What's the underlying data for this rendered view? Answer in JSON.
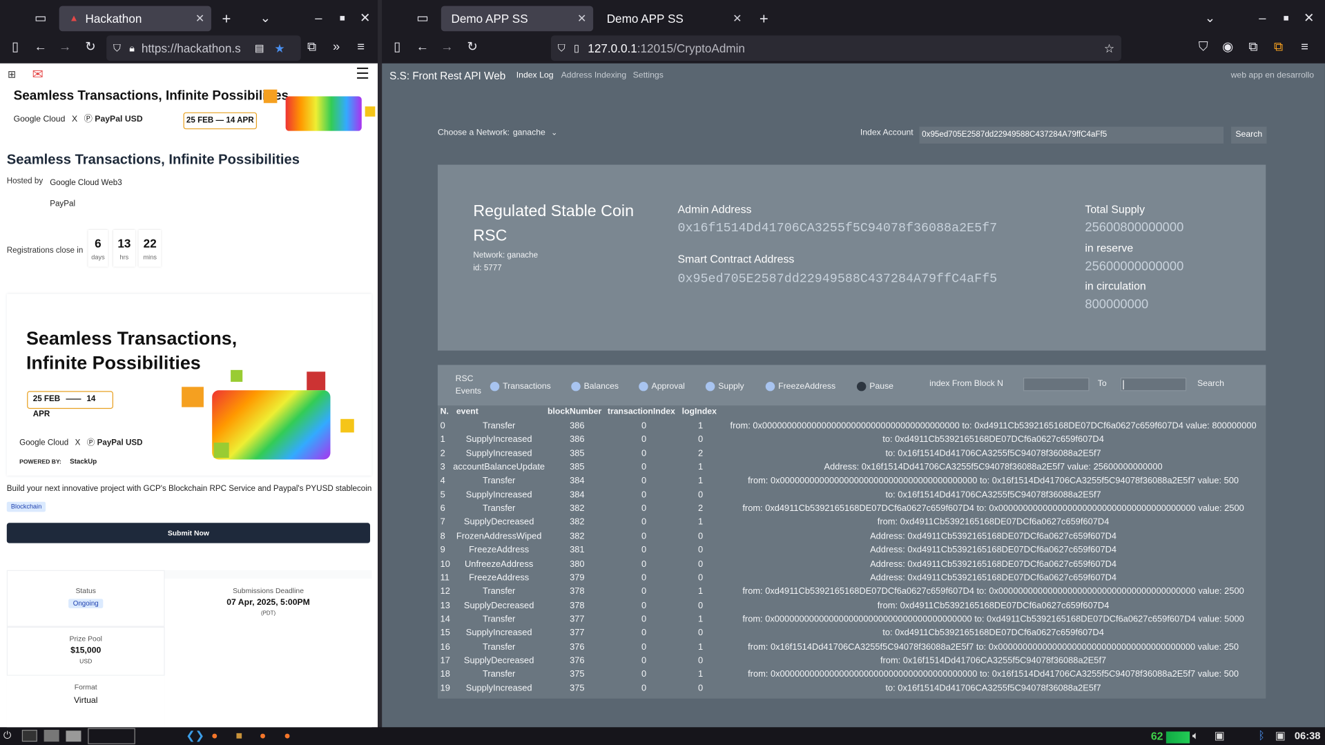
{
  "left_window": {
    "tab_title": "Hackathon",
    "url": "https://hackathon.s",
    "banner_title": "Seamless Transactions, Infinite Possibilities",
    "banner_brand_1": "Google Cloud",
    "banner_x": "X",
    "banner_brand_2": "PayPal USD",
    "banner_dates": "25 FEB — 14 APR",
    "title": "Seamless Transactions, Infinite Possibilities",
    "hosted_by_label": "Hosted by",
    "host_1": "Google Cloud Web3",
    "host_2": "PayPal",
    "registrations_label": "Registrations close in",
    "countdown": [
      {
        "value": "6",
        "unit": "days"
      },
      {
        "value": "13",
        "unit": "hrs"
      },
      {
        "value": "22",
        "unit": "mins"
      }
    ],
    "hero_title_1": "Seamless Transactions,",
    "hero_title_2": "Infinite Possibilities",
    "hero_date_from": "25 FEB",
    "hero_date_to": "14 APR",
    "hero_brand_1": "Google Cloud",
    "hero_brand_2": "PayPal USD",
    "hero_powered": "POWERED BY:",
    "hero_powered_brand": "StackUp",
    "description": "Build your next innovative project with GCP's Blockchain RPC Service and Paypal's PYUSD stablecoin",
    "tag": "Blockchain",
    "submit_label": "Submit Now",
    "status_label": "Status",
    "status_value": "Ongoing",
    "deadline_label": "Submissions Deadline",
    "deadline_value": "07 Apr, 2025, 5:00PM",
    "deadline_tz": "(PDT)",
    "prize_label": "Prize Pool",
    "prize_value": "$15,000",
    "prize_currency": "USD",
    "format_label": "Format",
    "format_value": "Virtual"
  },
  "right_window": {
    "tab_1": "Demo APP SS",
    "tab_2": "Demo APP SS",
    "url_host": "127.0.0.1",
    "url_rest": ":12015/CryptoAdmin",
    "brand": "S.S: Front Rest API Web",
    "nav": [
      "Index Log",
      "Address Indexing",
      "Settings"
    ],
    "nav_right": "web app en desarrollo",
    "network_label": "Choose a Network:",
    "network_value": "ganache",
    "index_label": "Index Account",
    "index_value": "0x95ed705E2587dd22949588C437284A79ffC4aFf5",
    "search_label": "Search",
    "coin_name": "Regulated Stable Coin",
    "coin_symbol": "RSC",
    "coin_network": "Network: ganache",
    "coin_id": "id: 5777",
    "admin_label": "Admin Address",
    "admin_value": "0x16f1514Dd41706CA3255f5C94078f36088a2E5f7",
    "contract_label": "Smart Contract Address",
    "contract_value": "0x95ed705E2587dd22949588C437284A79ffC4aFf5",
    "total_label": "Total Supply",
    "total_value": "25600800000000",
    "reserve_label": "in reserve",
    "reserve_value": "25600000000000",
    "circulation_label": "in circulation",
    "circulation_value": "800000000",
    "events_label_1": "RSC",
    "events_label_2": "Events",
    "filters": [
      "Transactions",
      "Balances",
      "Approval",
      "Supply",
      "FreezeAddress",
      "Pause"
    ],
    "from_block_label": "index From Block N",
    "to_label": "To",
    "search2_label": "Search",
    "columns": [
      "N.",
      "event",
      "blockNumber",
      "transactionIndex",
      "logIndex"
    ],
    "rows": [
      {
        "n": "0",
        "event": "Transfer",
        "block": "386",
        "tx": "0",
        "log": "1",
        "detail": "from: 0x0000000000000000000000000000000000000000 to: 0xd4911Cb5392165168DE07DCf6a0627c659f607D4 value: 800000000"
      },
      {
        "n": "1",
        "event": "SupplyIncreased",
        "block": "386",
        "tx": "0",
        "log": "0",
        "detail": "to: 0xd4911Cb5392165168DE07DCf6a0627c659f607D4"
      },
      {
        "n": "2",
        "event": "SupplyIncreased",
        "block": "385",
        "tx": "0",
        "log": "2",
        "detail": "to: 0x16f1514Dd41706CA3255f5C94078f36088a2E5f7"
      },
      {
        "n": "3",
        "event": "accountBalanceUpdate",
        "block": "385",
        "tx": "0",
        "log": "1",
        "detail": "Address: 0x16f1514Dd41706CA3255f5C94078f36088a2E5f7 value: 25600000000000"
      },
      {
        "n": "4",
        "event": "Transfer",
        "block": "384",
        "tx": "0",
        "log": "1",
        "detail": "from: 0x0000000000000000000000000000000000000000 to: 0x16f1514Dd41706CA3255f5C94078f36088a2E5f7 value: 500"
      },
      {
        "n": "5",
        "event": "SupplyIncreased",
        "block": "384",
        "tx": "0",
        "log": "0",
        "detail": "to: 0x16f1514Dd41706CA3255f5C94078f36088a2E5f7"
      },
      {
        "n": "6",
        "event": "Transfer",
        "block": "382",
        "tx": "0",
        "log": "2",
        "detail": "from: 0xd4911Cb5392165168DE07DCf6a0627c659f607D4 to: 0x0000000000000000000000000000000000000000 value: 2500"
      },
      {
        "n": "7",
        "event": "SupplyDecreased",
        "block": "382",
        "tx": "0",
        "log": "1",
        "detail": "from: 0xd4911Cb5392165168DE07DCf6a0627c659f607D4"
      },
      {
        "n": "8",
        "event": "FrozenAddressWiped",
        "block": "382",
        "tx": "0",
        "log": "0",
        "detail": "Address: 0xd4911Cb5392165168DE07DCf6a0627c659f607D4"
      },
      {
        "n": "9",
        "event": "FreezeAddress",
        "block": "381",
        "tx": "0",
        "log": "0",
        "detail": "Address: 0xd4911Cb5392165168DE07DCf6a0627c659f607D4"
      },
      {
        "n": "10",
        "event": "UnfreezeAddress",
        "block": "380",
        "tx": "0",
        "log": "0",
        "detail": "Address: 0xd4911Cb5392165168DE07DCf6a0627c659f607D4"
      },
      {
        "n": "11",
        "event": "FreezeAddress",
        "block": "379",
        "tx": "0",
        "log": "0",
        "detail": "Address: 0xd4911Cb5392165168DE07DCf6a0627c659f607D4"
      },
      {
        "n": "12",
        "event": "Transfer",
        "block": "378",
        "tx": "0",
        "log": "1",
        "detail": "from: 0xd4911Cb5392165168DE07DCf6a0627c659f607D4 to: 0x0000000000000000000000000000000000000000 value: 2500"
      },
      {
        "n": "13",
        "event": "SupplyDecreased",
        "block": "378",
        "tx": "0",
        "log": "0",
        "detail": "from: 0xd4911Cb5392165168DE07DCf6a0627c659f607D4"
      },
      {
        "n": "14",
        "event": "Transfer",
        "block": "377",
        "tx": "0",
        "log": "1",
        "detail": "from: 0x0000000000000000000000000000000000000000 to: 0xd4911Cb5392165168DE07DCf6a0627c659f607D4 value: 5000"
      },
      {
        "n": "15",
        "event": "SupplyIncreased",
        "block": "377",
        "tx": "0",
        "log": "0",
        "detail": "to: 0xd4911Cb5392165168DE07DCf6a0627c659f607D4"
      },
      {
        "n": "16",
        "event": "Transfer",
        "block": "376",
        "tx": "0",
        "log": "1",
        "detail": "from: 0x16f1514Dd41706CA3255f5C94078f36088a2E5f7 to: 0x0000000000000000000000000000000000000000 value: 250"
      },
      {
        "n": "17",
        "event": "SupplyDecreased",
        "block": "376",
        "tx": "0",
        "log": "0",
        "detail": "from: 0x16f1514Dd41706CA3255f5C94078f36088a2E5f7"
      },
      {
        "n": "18",
        "event": "Transfer",
        "block": "375",
        "tx": "0",
        "log": "1",
        "detail": "from: 0x0000000000000000000000000000000000000000 to: 0x16f1514Dd41706CA3255f5C94078f36088a2E5f7 value: 500"
      },
      {
        "n": "19",
        "event": "SupplyIncreased",
        "block": "375",
        "tx": "0",
        "log": "0",
        "detail": "to: 0x16f1514Dd41706CA3255f5C94078f36088a2E5f7"
      }
    ]
  },
  "taskbar": {
    "cpu": "62",
    "clock": "06:38"
  }
}
